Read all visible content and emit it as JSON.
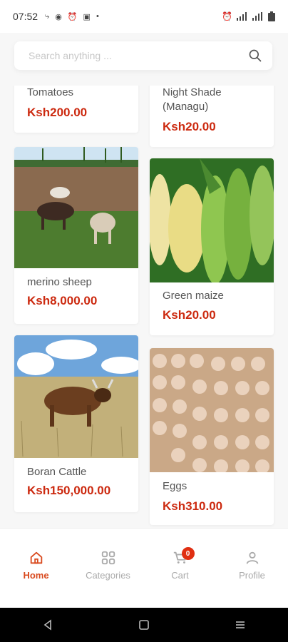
{
  "status": {
    "time": "07:52",
    "left_icons": [
      "share-icon",
      "location-icon",
      "alarm-icon",
      "message-icon",
      "dot-icon"
    ],
    "right_icons": [
      "alarm-icon",
      "signal-icon",
      "wifi-icon",
      "battery-icon"
    ]
  },
  "search": {
    "placeholder": "Search anything ..."
  },
  "products": [
    {
      "name": "Tomatoes",
      "price": "Ksh200.00"
    },
    {
      "name": "Night Shade (Managu)",
      "price": "Ksh20.00"
    },
    {
      "name": "merino sheep",
      "price": "Ksh8,000.00"
    },
    {
      "name": "Green maize",
      "price": "Ksh20.00"
    },
    {
      "name": "Boran Cattle",
      "price": "Ksh150,000.00"
    },
    {
      "name": "Eggs",
      "price": "Ksh310.00"
    }
  ],
  "nav": {
    "items": [
      {
        "label": "Home",
        "icon": "home-icon",
        "active": true
      },
      {
        "label": "Categories",
        "icon": "categories-icon"
      },
      {
        "label": "Cart",
        "icon": "cart-icon",
        "badge": "0"
      },
      {
        "label": "Profile",
        "icon": "profile-icon"
      }
    ]
  },
  "colors": {
    "accent": "#d94a1f",
    "price": "#cc2a10",
    "badge": "#e02f12"
  }
}
